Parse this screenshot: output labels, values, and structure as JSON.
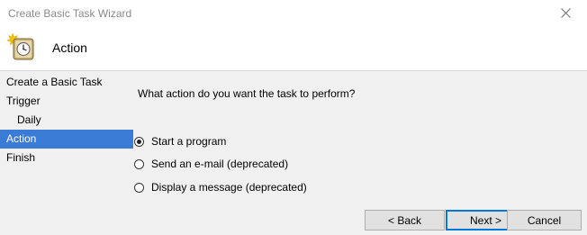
{
  "window": {
    "title": "Create Basic Task Wizard",
    "close_icon": "close-icon"
  },
  "header": {
    "icon": "task-scheduler-clock-icon",
    "title": "Action"
  },
  "steps": [
    {
      "label": "Create a Basic Task",
      "active": false
    },
    {
      "label": "Trigger",
      "active": false
    },
    {
      "label": "Daily",
      "active": false
    },
    {
      "label": "Action",
      "active": true
    },
    {
      "label": "Finish",
      "active": false
    }
  ],
  "main": {
    "question": "What action do you want the task to perform?",
    "options": [
      {
        "label": "Start a program",
        "selected": true
      },
      {
        "label": "Send an e-mail (deprecated)",
        "selected": false
      },
      {
        "label": "Display a message (deprecated)",
        "selected": false
      }
    ]
  },
  "buttons": {
    "back": "< Back",
    "next": "Next >",
    "cancel": "Cancel"
  },
  "colors": {
    "selection": "#3a7bd5",
    "panel_bg": "#f0f0f0",
    "button_bg": "#e1e1e1",
    "default_button_border": "#0078d7"
  }
}
